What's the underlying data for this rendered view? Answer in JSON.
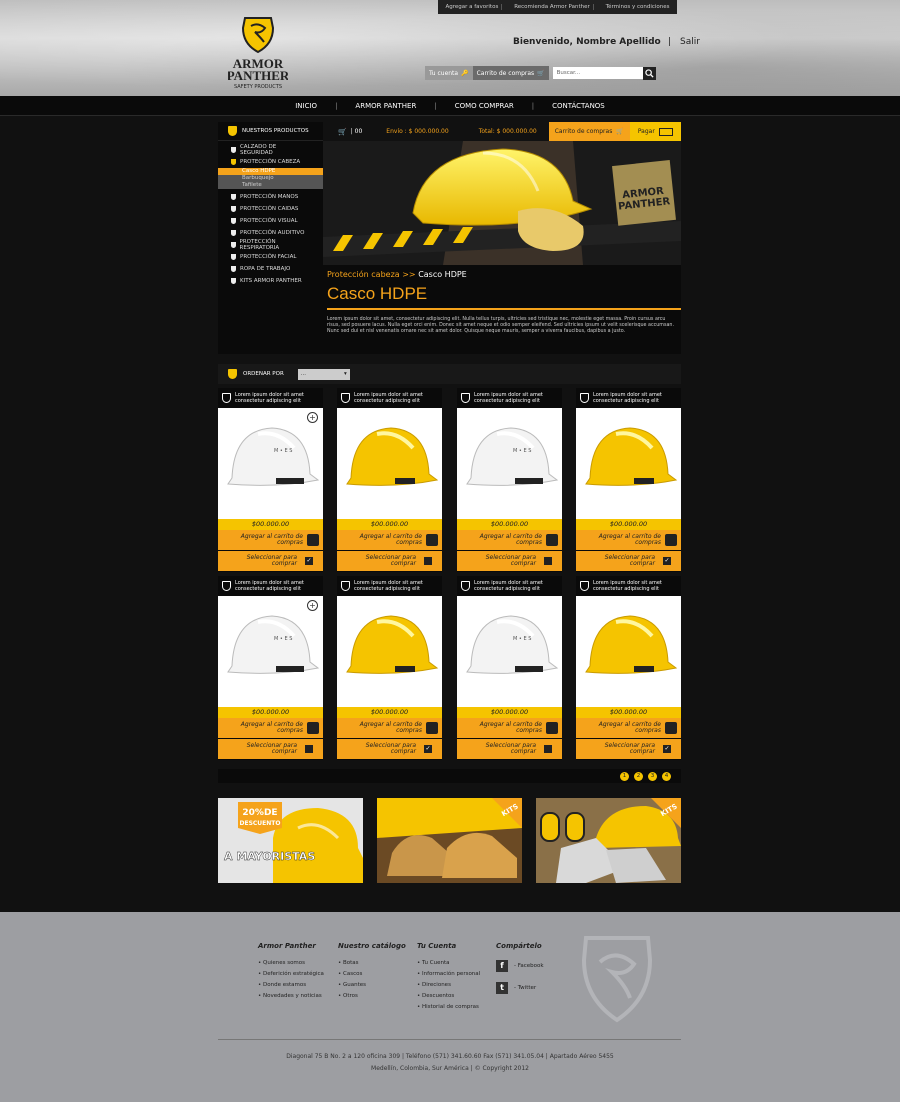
{
  "header": {
    "top_links": [
      "Agregar a favoritos",
      "Recomienda Armor Panther",
      "Términos y condiciones"
    ],
    "logo_text_1": "ARMOR",
    "logo_text_2": "PANTHER",
    "logo_text_3": "SAFETY PRODUCTS",
    "welcome": "Bienvenido, Nombre Apellido",
    "salir": "Salir",
    "tu_cuenta": "Tu cuenta",
    "carrito": "Carrito de compras",
    "search_placeholder": "Buscar..."
  },
  "nav": [
    "INICIO",
    "ARMOR PANTHER",
    "COMO COMPRAR",
    "CONTÁCTANOS"
  ],
  "sidebar": {
    "title": "NUESTROS PRODUCTOS",
    "items": [
      {
        "label": "CALZADO DE SEGURIDAD"
      },
      {
        "label": "PROTECCIÓN CABEZA",
        "active": true
      },
      {
        "label": "PROTECCIÓN MANOS"
      },
      {
        "label": "PROTECCIÓN CAIDAS"
      },
      {
        "label": "PROTECCIÓN VISUAL"
      },
      {
        "label": "PROTECCIÓN AUDITIVO"
      },
      {
        "label": "PROTECCIÓN RESPIRATORIA"
      },
      {
        "label": "PROTECCIÓN FACIAL"
      },
      {
        "label": "ROPA DE TRABAJO"
      },
      {
        "label": "KITS ARMOR PANTHER"
      }
    ],
    "subitems": [
      "Casco HDPE",
      "Barbuquejo",
      "Tafilete"
    ]
  },
  "topbar": {
    "count": "| 00",
    "envio": "Envío : $ 000.000.00",
    "total": "Total: $ 000.000.00",
    "cart": "Carrito de compras",
    "pagar": "Pagar"
  },
  "product_page": {
    "crumb_parent": "Protección cabeza >>",
    "crumb_current": "Casco HDPE",
    "title": "Casco HDPE",
    "description": "Lorem ipsum dolor sit amet, consectetur adipiscing elit. Nulla tellus turpis, ultricies sed tristique nec, molestie eget massa. Proin cursus arcu risus, sed posuere lacus. Nulla eget orci enim. Donec sit amet neque et odio semper eleifend. Sed ultricies ipsum ut velit scelerisque accumsan. Nunc sed dui et nisl venenatis ornare nec sit amet dolor. Quisque neque mauris, semper a viverra faucibus, dapibus a justo."
  },
  "order": {
    "label": "ORDENAR POR",
    "value": "..."
  },
  "products": [
    {
      "title": "Lorem ipsum dolor sit amet consectetur adipiscing elit",
      "price": "$00.000.00",
      "add": "Agregar al carrito de compras",
      "select": "Seleccionar para comprar",
      "color": "white",
      "checked": true,
      "zoom": true
    },
    {
      "title": "Lorem ipsum dolor sit amet consectetur adipiscing elit",
      "price": "$00.000.00",
      "add": "Agregar al carrito de compras",
      "select": "Seleccionar para comprar",
      "color": "yellow",
      "checked": false
    },
    {
      "title": "Lorem ipsum dolor sit amet consectetur adipiscing elit",
      "price": "$00.000.00",
      "add": "Agregar al carrito de compras",
      "select": "Seleccionar para comprar",
      "color": "white",
      "checked": false
    },
    {
      "title": "Lorem ipsum dolor sit amet consectetur adipiscing elit",
      "price": "$00.000.00",
      "add": "Agregar al carrito de compras",
      "select": "Seleccionar para comprar",
      "color": "yellow",
      "checked": true
    },
    {
      "title": "Lorem ipsum dolor sit amet consectetur adipiscing elit",
      "price": "$00.000.00",
      "add": "Agregar al carrito de compras",
      "select": "Seleccionar para comprar",
      "color": "white",
      "checked": false,
      "zoom": true
    },
    {
      "title": "Lorem ipsum dolor sit amet consectetur adipiscing elit",
      "price": "$00.000.00",
      "add": "Agregar al carrito de compras",
      "select": "Seleccionar para comprar",
      "color": "yellow",
      "checked": true
    },
    {
      "title": "Lorem ipsum dolor sit amet consectetur adipiscing elit",
      "price": "$00.000.00",
      "add": "Agregar al carrito de compras",
      "select": "Seleccionar para comprar",
      "color": "white",
      "checked": false
    },
    {
      "title": "Lorem ipsum dolor sit amet consectetur adipiscing elit",
      "price": "$00.000.00",
      "add": "Agregar al carrito de compras",
      "select": "Seleccionar para comprar",
      "color": "yellow",
      "checked": true
    }
  ],
  "pages": [
    "1",
    "2",
    "3",
    "4"
  ],
  "promos": {
    "p1_badge": "20%DE DESCUENTO",
    "p1_text": "A MAYORISTAS",
    "kits": "KITS"
  },
  "footer": {
    "cols": [
      {
        "title": "Armor Panther",
        "links": [
          "• Quienes somos",
          "• Deferición estratégica",
          "• Donde estamos",
          "• Novedades y noticias"
        ]
      },
      {
        "title": "Nuestro catálogo",
        "links": [
          "• Botas",
          "• Cascos",
          "• Guantes",
          "• Otros"
        ]
      },
      {
        "title": "Tu Cuenta",
        "links": [
          "• Tu Cuenta",
          "• Información personal",
          "• Direciones",
          "• Descuentos",
          "• Historial de compras"
        ]
      }
    ],
    "share_title": "Compártelo",
    "facebook": "- Facebook",
    "twitter": "- Twitter",
    "address": "Diagonal 75 B No. 2 a 120 oficina 309   |   Teléfono (571) 341.60.60 Fax (571) 341.05.04   |   Apartado Aéreo 5455",
    "address2": "Medellín, Colombia, Sur América   |   © Copyright 2012"
  },
  "colors": {
    "accent_orange": "#f5a31b",
    "accent_yellow": "#f5c400",
    "bg": "#111111"
  }
}
